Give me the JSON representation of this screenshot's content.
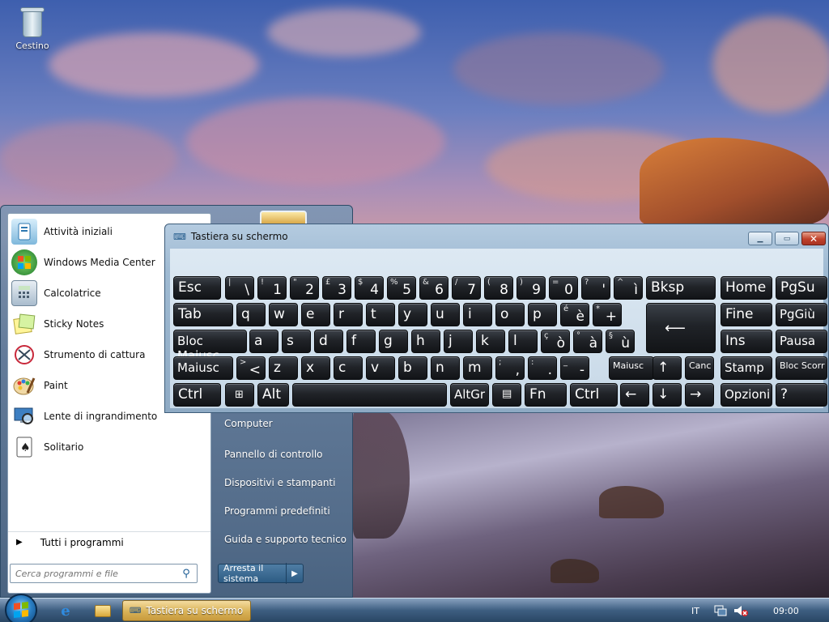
{
  "desktop": {
    "recycle_bin_label": "Cestino"
  },
  "start_menu": {
    "programs": [
      {
        "label": "Attività iniziali",
        "icon": "getting-started-icon"
      },
      {
        "label": "Windows Media Center",
        "icon": "media-center-icon"
      },
      {
        "label": "Calcolatrice",
        "icon": "calculator-icon"
      },
      {
        "label": "Sticky Notes",
        "icon": "sticky-notes-icon"
      },
      {
        "label": "Strumento di cattura",
        "icon": "snipping-tool-icon"
      },
      {
        "label": "Paint",
        "icon": "paint-icon"
      },
      {
        "label": "Lente di ingrandimento",
        "icon": "magnifier-icon"
      },
      {
        "label": "Solitario",
        "icon": "solitaire-icon"
      }
    ],
    "all_programs": "Tutti i programmi",
    "search_placeholder": "Cerca programmi e file",
    "right_items": [
      "Computer",
      "Pannello di controllo",
      "Dispositivi e stampanti",
      "Programmi predefiniti",
      "Guida e supporto tecnico"
    ],
    "shutdown_label": "Arresta il sistema"
  },
  "osk": {
    "title": "Tastiera su schermo",
    "rows": [
      [
        {
          "main": "Esc"
        },
        {
          "sm": "|",
          "big": "\\"
        },
        {
          "sm": "!",
          "big": "1"
        },
        {
          "sm": "\"",
          "big": "2"
        },
        {
          "sm": "£",
          "big": "3"
        },
        {
          "sm": "$",
          "big": "4"
        },
        {
          "sm": "%",
          "big": "5"
        },
        {
          "sm": "&",
          "big": "6"
        },
        {
          "sm": "/",
          "big": "7"
        },
        {
          "sm": "(",
          "big": "8"
        },
        {
          "sm": ")",
          "big": "9"
        },
        {
          "sm": "=",
          "big": "0"
        },
        {
          "sm": "?",
          "big": "'"
        },
        {
          "sm": "^",
          "big": "ì"
        },
        {
          "main": "Bksp"
        },
        {
          "main": "Home"
        },
        {
          "main": "PgSu"
        }
      ],
      [
        {
          "main": "Tab"
        },
        {
          "main": "q"
        },
        {
          "main": "w"
        },
        {
          "main": "e"
        },
        {
          "main": "r"
        },
        {
          "main": "t"
        },
        {
          "main": "y"
        },
        {
          "main": "u"
        },
        {
          "main": "i"
        },
        {
          "main": "o"
        },
        {
          "main": "p"
        },
        {
          "sm": "é",
          "big": "è"
        },
        {
          "sm": "*",
          "big": "+"
        },
        {
          "main": "Fine"
        },
        {
          "main": "PgGiù"
        }
      ],
      [
        {
          "main": "Bloc Maiusc"
        },
        {
          "main": "a"
        },
        {
          "main": "s"
        },
        {
          "main": "d"
        },
        {
          "main": "f"
        },
        {
          "main": "g"
        },
        {
          "main": "h"
        },
        {
          "main": "j"
        },
        {
          "main": "k"
        },
        {
          "main": "l"
        },
        {
          "sm": "ç",
          "big": "ò"
        },
        {
          "sm": "°",
          "big": "à"
        },
        {
          "sm": "§",
          "big": "ù"
        },
        {
          "main": "Ins"
        },
        {
          "main": "Pausa"
        }
      ],
      [
        {
          "main": "Maiusc"
        },
        {
          "sm": ">",
          "big": "<"
        },
        {
          "main": "z"
        },
        {
          "main": "x"
        },
        {
          "main": "c"
        },
        {
          "main": "v"
        },
        {
          "main": "b"
        },
        {
          "main": "n"
        },
        {
          "main": "m"
        },
        {
          "sm": ";",
          "big": ","
        },
        {
          "sm": ":",
          "big": "."
        },
        {
          "sm": "_",
          "big": "-"
        },
        {
          "main": "Maiusc"
        },
        {
          "main": "↑"
        },
        {
          "main": "Canc"
        },
        {
          "main": "Stamp"
        },
        {
          "main": "Bloc Scorr"
        }
      ],
      [
        {
          "main": "Ctrl"
        },
        {
          "main": ""
        },
        {
          "main": "Alt"
        },
        {
          "main": ""
        },
        {
          "main": "AltGr"
        },
        {
          "main": ""
        },
        {
          "main": "Fn"
        },
        {
          "main": "Ctrl"
        },
        {
          "main": "←"
        },
        {
          "main": "↓"
        },
        {
          "main": "→"
        },
        {
          "main": "Opzioni"
        },
        {
          "main": "?"
        }
      ]
    ]
  },
  "taskbar": {
    "active_task": "Tastiera su schermo",
    "language": "IT",
    "clock": "09:00"
  }
}
